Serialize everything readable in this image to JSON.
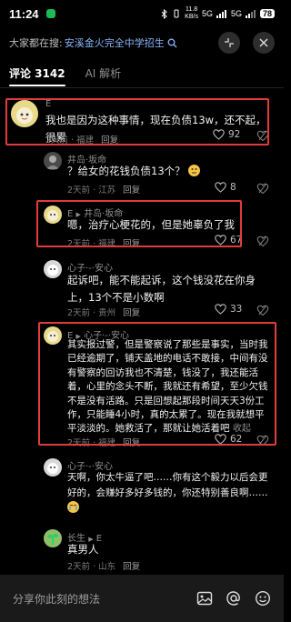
{
  "status": {
    "time": "11:24",
    "net_speed_top": "11.8",
    "net_speed_unit": "KB/s",
    "signal": "5G",
    "signal2": "5G",
    "battery": "78"
  },
  "search": {
    "prefix": "大家都在搜:",
    "term": "安溪金火完全中学招生"
  },
  "tabs": {
    "comments": "评论 3142",
    "ai": "AI 解析"
  },
  "comments": [
    {
      "author": "E",
      "body": "我也是因为这种事情，现在负债13w，还不起，很累",
      "time": "2天前",
      "location": "福建",
      "reply": "回复",
      "likes": "92"
    },
    {
      "author": "井岛·坂命",
      "body": "？给女的花钱负债13个？",
      "time": "2天前",
      "location": "江苏",
      "reply": "回复",
      "likes": "8"
    },
    {
      "author": "E",
      "author_arrow": "▶",
      "author_target": "井岛·坂命",
      "body": "嗯，治疗心梗花的，但是她辜负了我",
      "time": "2天前",
      "location": "福建",
      "reply": "回复",
      "likes": "67"
    },
    {
      "author": "心子·-·安心",
      "body": "起诉吧，能不能起诉，这个钱没花在你身上，13个不是小数啊",
      "time": "2天前",
      "location": "贵州",
      "reply": "回复",
      "likes": "33"
    },
    {
      "author": "E",
      "author_arrow": "▶",
      "author_target": "心子·-·安心",
      "body": "其实报过警，但是警察说了那些是事实，当时我已经逾期了，铺天盖地的电话不敢接，中间有没有警察的回访我也不清楚，钱没了，我还能活着，心里的念头不断，我就还有希望，至少欠钱不是没有活路。只是回想起那段时间天天3份工作，只能睡4小时，真的太累了。现在我就想平平淡淡的。她救活了，那就让她活着吧",
      "collapse": "收起",
      "time": "2天前",
      "location": "福建",
      "reply": "回复",
      "likes": "62"
    },
    {
      "author": "心子·-·安心",
      "body": "天啊，你太牛逼了吧……你有这个毅力以后会更好的，会赚好多好多钱的，你还特别善良啊……",
      "time": "",
      "location": "",
      "reply": "",
      "likes": ""
    },
    {
      "author": "长生",
      "author_arrow": "▶",
      "author_target": "E",
      "body": "真男人",
      "time": "2天前",
      "location": "山东",
      "reply": "回复",
      "likes": ""
    }
  ],
  "bottom": {
    "placeholder": "分享你此刻的想法"
  },
  "colors": {
    "highlight_box": "#e23b3b",
    "search_term": "#8ab4f8"
  }
}
